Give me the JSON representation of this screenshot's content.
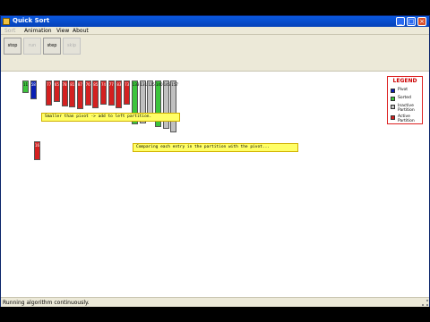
{
  "window": {
    "title": "Quick Sort",
    "controls": {
      "minimize": "_",
      "maximize": "□",
      "close": "×"
    }
  },
  "menu": {
    "file": "Sort",
    "animation": "Animation",
    "view": "View",
    "about": "About"
  },
  "toolbar": {
    "stop": "stop",
    "run": "run",
    "step": "step",
    "skip": "skip"
  },
  "legend": {
    "title": "LEGEND",
    "items": [
      {
        "label": "Pivot",
        "color": "#0a1fb4"
      },
      {
        "label": "Sorted",
        "color": "#3cc43c"
      },
      {
        "label": "Inactive Partition",
        "color": "#c0c0c0"
      },
      {
        "label": "Active Partition",
        "color": "#d42020"
      }
    ]
  },
  "bars": [
    {
      "value": "11",
      "state": "sorted"
    },
    {
      "value": "58",
      "state": "pivot"
    },
    {
      "value": "",
      "state": "gap"
    },
    {
      "value": "77",
      "state": "active"
    },
    {
      "value": "65",
      "state": "active"
    },
    {
      "value": "78",
      "state": "active"
    },
    {
      "value": "81",
      "state": "active"
    },
    {
      "value": "87",
      "state": "active"
    },
    {
      "value": "76",
      "state": "active"
    },
    {
      "value": "85",
      "state": "active"
    },
    {
      "value": "74",
      "state": "active"
    },
    {
      "value": "77",
      "state": "active"
    },
    {
      "value": "83",
      "state": "active"
    },
    {
      "value": "73",
      "state": "active"
    },
    {
      "value": "133",
      "state": "sorted"
    },
    {
      "value": "131",
      "state": "inactive"
    },
    {
      "value": "125",
      "state": "inactive"
    },
    {
      "value": "140",
      "state": "sorted"
    },
    {
      "value": "145",
      "state": "inactive"
    },
    {
      "value": "157",
      "state": "inactive"
    }
  ],
  "floating_bar": {
    "value": "16",
    "state": "active"
  },
  "callouts": {
    "left": "Smaller than pivot -> add to left partition.",
    "right": "Comparing each entry in the partition with the pivot..."
  },
  "status": "Running algorithm continuously."
}
